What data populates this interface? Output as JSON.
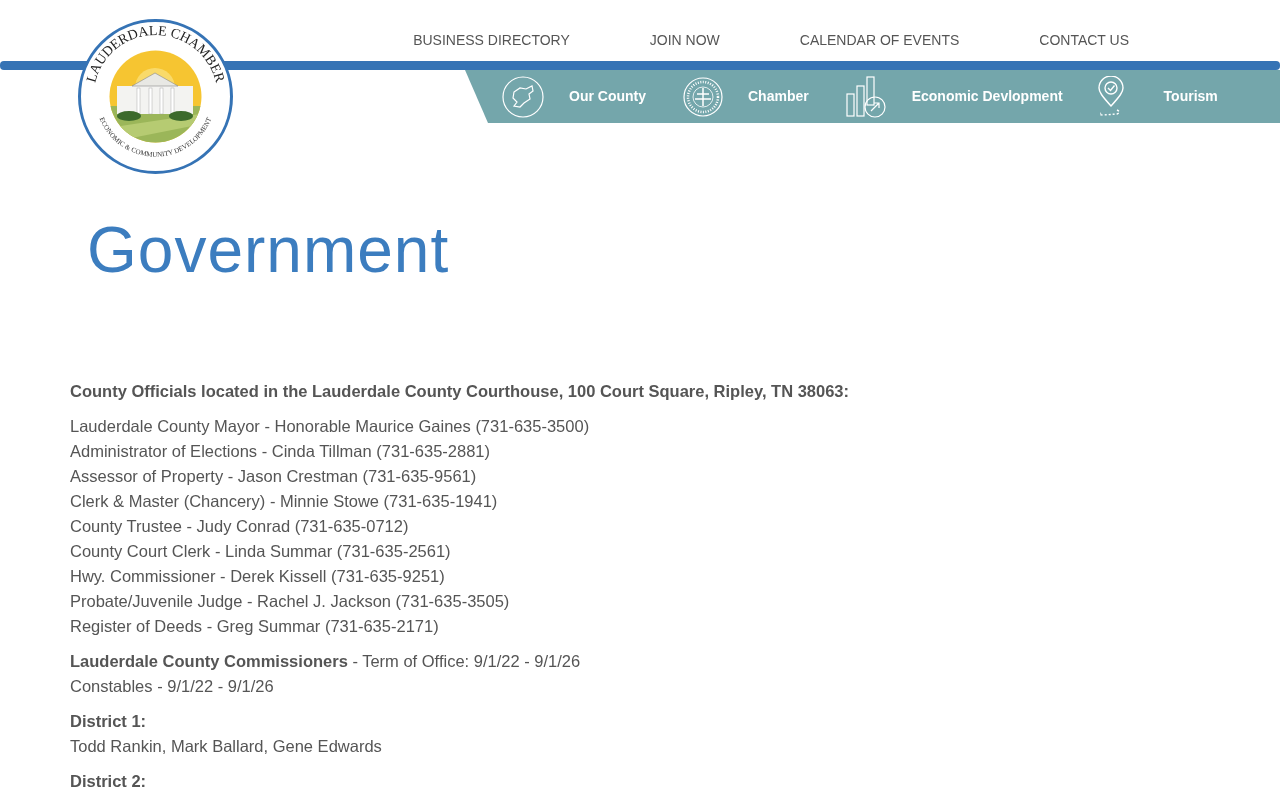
{
  "logo": {
    "title": "LAUDERDALE CHAMBER",
    "tagline": "ECONOMIC & COMMUNITY DEVELOPMENT"
  },
  "top_nav": [
    "BUSINESS DIRECTORY",
    "JOIN NOW",
    "CALENDAR OF EVENTS",
    "CONTACT US"
  ],
  "sub_nav": [
    {
      "label": "Our County",
      "kind": "map"
    },
    {
      "label": "Chamber",
      "kind": "seal"
    },
    {
      "label": "Economic Devlopment",
      "kind": "chart"
    },
    {
      "label": "Tourism",
      "kind": "pin"
    }
  ],
  "page_title": "Government",
  "sections": [
    {
      "kind": "heading",
      "text": "County Officials located in the Lauderdale County Courthouse, 100 Court Square, Ripley, TN 38063:"
    },
    {
      "kind": "lines",
      "lines": [
        "Lauderdale County Mayor - Honorable Maurice Gaines (731-635-3500)",
        "Administrator of Elections - Cinda Tillman (731-635-2881)",
        "Assessor of Property - Jason Crestman (731-635-9561)",
        "Clerk & Master (Chancery) - Minnie Stowe (731-635-1941)",
        "County Trustee - Judy Conrad (731-635-0712)",
        "County Court Clerk - Linda Summar (731-635-2561)",
        "Hwy. Commissioner - Derek Kissell (731-635-9251)",
        "Probate/Juvenile Judge - Rachel J. Jackson (731-635-3505)",
        "Register of Deeds - Greg Summar (731-635-2171)"
      ]
    },
    {
      "kind": "lines",
      "lines": [
        "**Lauderdale County Commissioners** - Term of Office: 9/1/22 - 9/1/26",
        "Constables - 9/1/22 - 9/1/26"
      ]
    },
    {
      "kind": "district",
      "title": "District 1:",
      "text": "Todd Rankin, Mark Ballard, Gene Edwards"
    },
    {
      "kind": "district",
      "title": "District 2:"
    }
  ]
}
